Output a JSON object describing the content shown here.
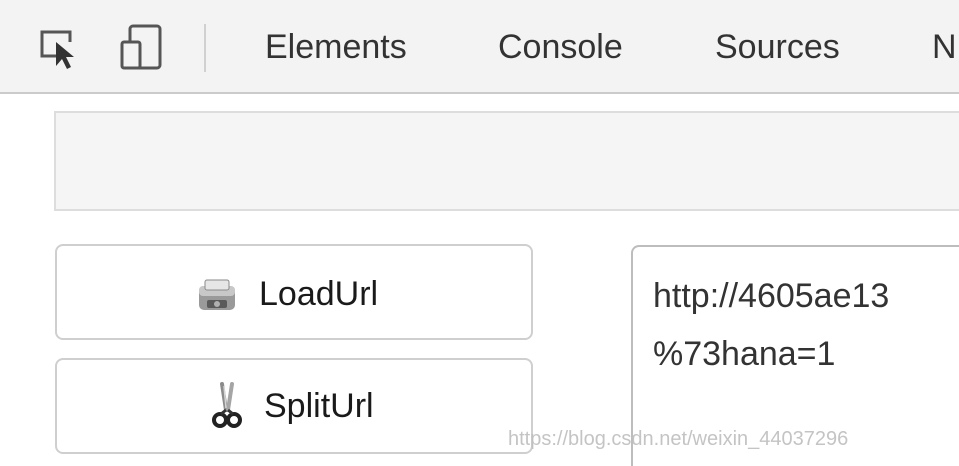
{
  "toolbar": {
    "tabs": [
      {
        "label": "Elements"
      },
      {
        "label": "Console"
      },
      {
        "label": "Sources"
      },
      {
        "label": "N"
      }
    ],
    "icons": [
      "inspect-element-icon",
      "device-toolbar-icon"
    ]
  },
  "buttons": {
    "load_url": {
      "label": "LoadUrl",
      "icon": "load-url-icon"
    },
    "split_url": {
      "label": "SplitUrl",
      "icon": "scissors-icon"
    }
  },
  "url_box": {
    "line1": "http://4605ae13",
    "line2": "%73hana=1"
  },
  "watermark": {
    "text": "https://blog.csdn.net/weixin_44037296"
  },
  "colors": {
    "toolbar_bg": "#f3f3f3",
    "tab_text": "#333333",
    "panel_bg": "#f5f5f5",
    "border": "#cfcfcf"
  }
}
